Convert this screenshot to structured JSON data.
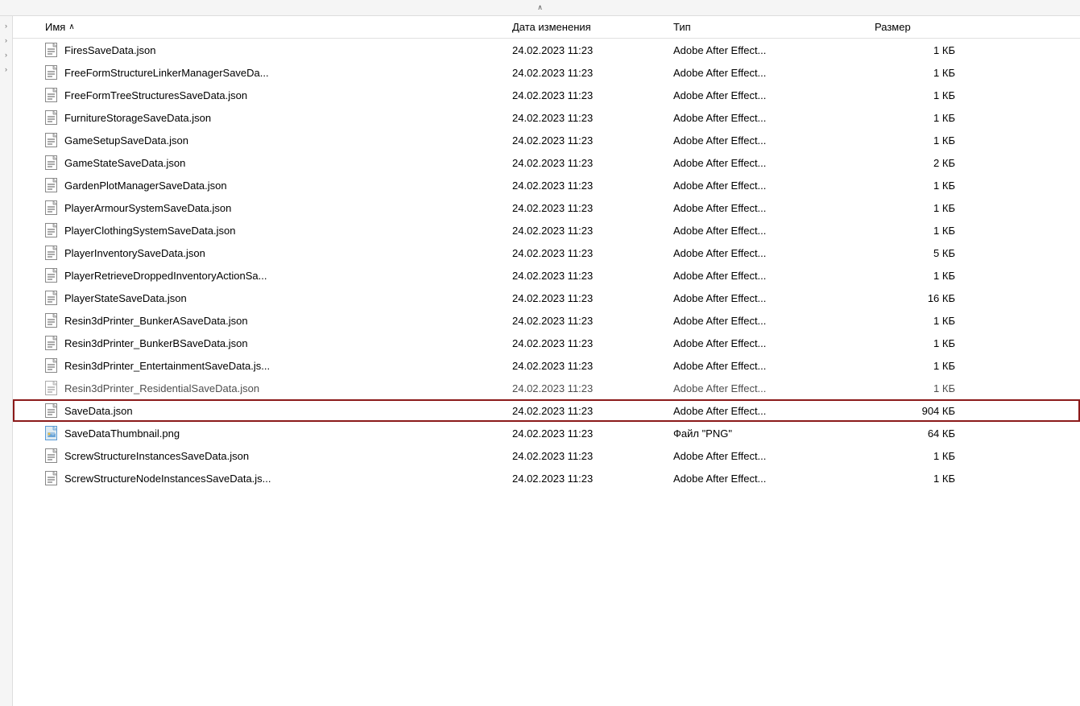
{
  "header": {
    "columns": {
      "name": "Имя",
      "date": "Дата изменения",
      "type": "Тип",
      "size": "Размер"
    }
  },
  "files": [
    {
      "id": 1,
      "name": "FiresSaveData.json",
      "date": "24.02.2023 11:23",
      "type": "Adobe After Effect...",
      "size": "1 КБ",
      "icon": "json",
      "highlighted": false
    },
    {
      "id": 2,
      "name": "FreeFormStructureLinkerManagerSaveDa...",
      "date": "24.02.2023 11:23",
      "type": "Adobe After Effect...",
      "size": "1 КБ",
      "icon": "json",
      "highlighted": false
    },
    {
      "id": 3,
      "name": "FreeFormTreeStructuresSaveData.json",
      "date": "24.02.2023 11:23",
      "type": "Adobe After Effect...",
      "size": "1 КБ",
      "icon": "json",
      "highlighted": false
    },
    {
      "id": 4,
      "name": "FurnitureStorageSaveData.json",
      "date": "24.02.2023 11:23",
      "type": "Adobe After Effect...",
      "size": "1 КБ",
      "icon": "json",
      "highlighted": false
    },
    {
      "id": 5,
      "name": "GameSetupSaveData.json",
      "date": "24.02.2023 11:23",
      "type": "Adobe After Effect...",
      "size": "1 КБ",
      "icon": "json",
      "highlighted": false
    },
    {
      "id": 6,
      "name": "GameStateSaveData.json",
      "date": "24.02.2023 11:23",
      "type": "Adobe After Effect...",
      "size": "2 КБ",
      "icon": "json",
      "highlighted": false
    },
    {
      "id": 7,
      "name": "GardenPlotManagerSaveData.json",
      "date": "24.02.2023 11:23",
      "type": "Adobe After Effect...",
      "size": "1 КБ",
      "icon": "json",
      "highlighted": false
    },
    {
      "id": 8,
      "name": "PlayerArmourSystemSaveData.json",
      "date": "24.02.2023 11:23",
      "type": "Adobe After Effect...",
      "size": "1 КБ",
      "icon": "json",
      "highlighted": false
    },
    {
      "id": 9,
      "name": "PlayerClothingSystemSaveData.json",
      "date": "24.02.2023 11:23",
      "type": "Adobe After Effect...",
      "size": "1 КБ",
      "icon": "json",
      "highlighted": false
    },
    {
      "id": 10,
      "name": "PlayerInventorySaveData.json",
      "date": "24.02.2023 11:23",
      "type": "Adobe After Effect...",
      "size": "5 КБ",
      "icon": "json",
      "highlighted": false
    },
    {
      "id": 11,
      "name": "PlayerRetrieveDroppedInventoryActionSa...",
      "date": "24.02.2023 11:23",
      "type": "Adobe After Effect...",
      "size": "1 КБ",
      "icon": "json",
      "highlighted": false
    },
    {
      "id": 12,
      "name": "PlayerStateSaveData.json",
      "date": "24.02.2023 11:23",
      "type": "Adobe After Effect...",
      "size": "16 КБ",
      "icon": "json",
      "highlighted": false
    },
    {
      "id": 13,
      "name": "Resin3dPrinter_BunkerASaveData.json",
      "date": "24.02.2023 11:23",
      "type": "Adobe After Effect...",
      "size": "1 КБ",
      "icon": "json",
      "highlighted": false
    },
    {
      "id": 14,
      "name": "Resin3dPrinter_BunkerBSaveData.json",
      "date": "24.02.2023 11:23",
      "type": "Adobe After Effect...",
      "size": "1 КБ",
      "icon": "json",
      "highlighted": false
    },
    {
      "id": 15,
      "name": "Resin3dPrinter_EntertainmentSaveData.js...",
      "date": "24.02.2023 11:23",
      "type": "Adobe After Effect...",
      "size": "1 КБ",
      "icon": "json",
      "highlighted": false
    },
    {
      "id": 16,
      "name": "Resin3dPrinter_ResidentialSaveData.json",
      "date": "24.02.2023 11:23",
      "type": "Adobe After Effect...",
      "size": "1 КБ",
      "icon": "json",
      "highlighted": false,
      "faded": true
    },
    {
      "id": 17,
      "name": "SaveData.json",
      "date": "24.02.2023 11:23",
      "type": "Adobe After Effect...",
      "size": "904 КБ",
      "icon": "json",
      "highlighted": true
    },
    {
      "id": 18,
      "name": "SaveDataThumbnail.png",
      "date": "24.02.2023 11:23",
      "type": "Файл \"PNG\"",
      "size": "64 КБ",
      "icon": "png",
      "highlighted": false
    },
    {
      "id": 19,
      "name": "ScrewStructureInstancesSaveData.json",
      "date": "24.02.2023 11:23",
      "type": "Adobe After Effect...",
      "size": "1 КБ",
      "icon": "json",
      "highlighted": false
    },
    {
      "id": 20,
      "name": "ScrewStructureNodeInstancesSaveData.js...",
      "date": "24.02.2023 11:23",
      "type": "Adobe After Effect...",
      "size": "1 КБ",
      "icon": "json",
      "highlighted": false
    }
  ]
}
